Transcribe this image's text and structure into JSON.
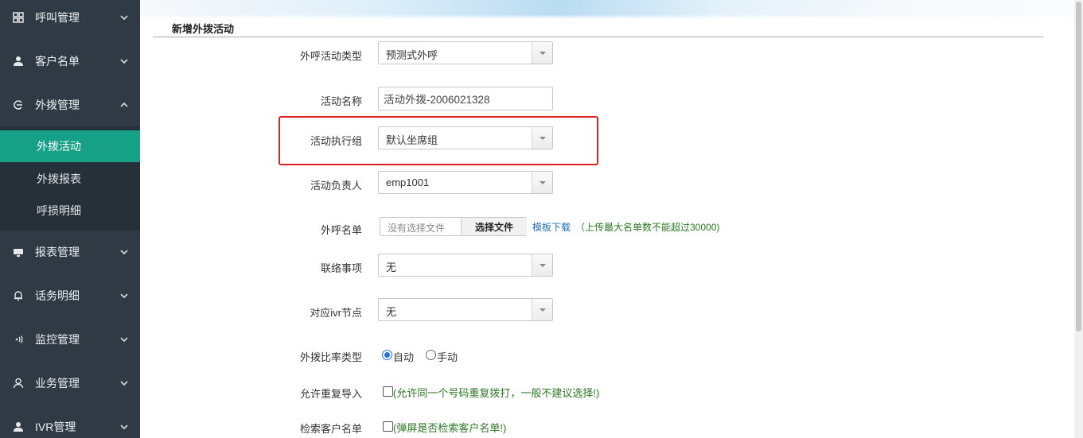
{
  "sidebar": {
    "items": [
      {
        "label": "呼叫管理",
        "icon": "grid-icon",
        "expanded": false
      },
      {
        "label": "客户名单",
        "icon": "user-icon",
        "expanded": false
      },
      {
        "label": "外拨管理",
        "icon": "outbound-icon",
        "expanded": true
      },
      {
        "label": "报表管理",
        "icon": "monitor-icon",
        "expanded": false
      },
      {
        "label": "话务明细",
        "icon": "bell-icon",
        "expanded": false
      },
      {
        "label": "监控管理",
        "icon": "signal-icon",
        "expanded": false
      },
      {
        "label": "业务管理",
        "icon": "person-icon",
        "expanded": false
      },
      {
        "label": "IVR管理",
        "icon": "user-icon",
        "expanded": false
      }
    ],
    "subitems": [
      {
        "label": "外拨活动",
        "active": true
      },
      {
        "label": "外拨报表",
        "active": false
      },
      {
        "label": "呼损明细",
        "active": false
      }
    ]
  },
  "main": {
    "section_title": "新增外拨活动",
    "fields": {
      "activity_type": {
        "label": "外呼活动类型",
        "value": "预测式外呼"
      },
      "activity_name": {
        "label": "活动名称",
        "value": "活动外拨-2006021328"
      },
      "exec_group": {
        "label": "活动执行组",
        "value": "默认坐席组"
      },
      "owner": {
        "label": "活动负责人",
        "value": "emp1001"
      },
      "call_list": {
        "label": "外呼名单",
        "placeholder": "没有选择文件",
        "button": "选择文件",
        "link": "模板下载",
        "hint": "（上传最大名单数不能超过30000)"
      },
      "contact_item": {
        "label": "联络事项",
        "value": "无"
      },
      "ivr_node": {
        "label": "对应ivr节点",
        "value": "无"
      },
      "ratio_type": {
        "label": "外拨比率类型",
        "options": [
          "自动",
          "手动"
        ],
        "selected": "自动"
      },
      "allow_repeat": {
        "label": "允许重复导入",
        "checked": false,
        "hint": "(允许同一个号码重复拨打，一般不建议选择!)"
      },
      "search_customer": {
        "label": "检索客户名单",
        "checked": false,
        "hint": "(弹屏是否检索客户名单!)"
      }
    }
  },
  "colors": {
    "sidebar_bg": "#2f3a44",
    "sub_bg": "#263038",
    "active": "#16a085",
    "highlight_border": "#e02020",
    "hint_green": "#2a7a22",
    "link_blue": "#1f6fb5"
  }
}
